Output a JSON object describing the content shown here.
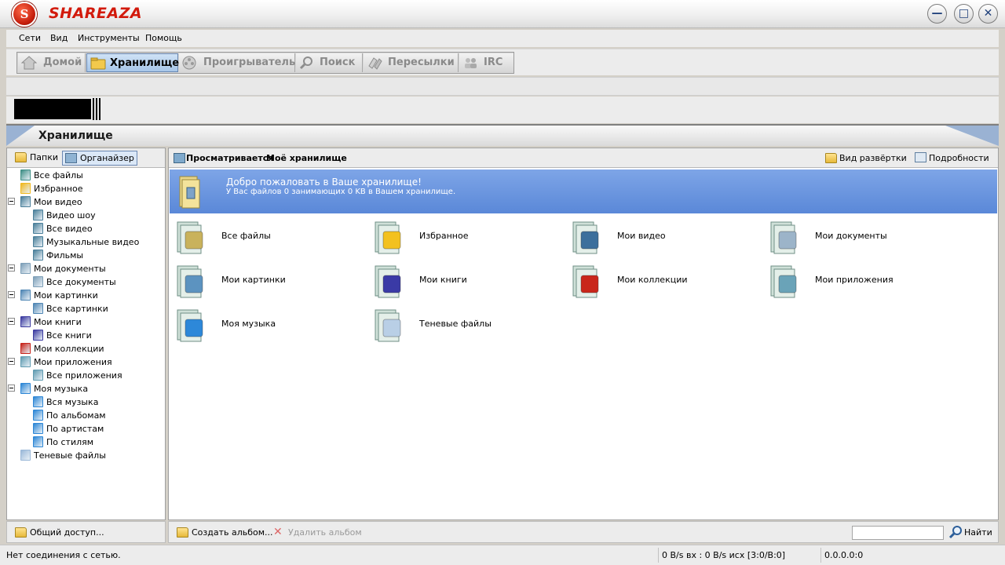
{
  "app": {
    "title": "SHAREAZA",
    "logo_letter": "S"
  },
  "window_buttons": [
    "—",
    "□",
    "✕"
  ],
  "menu": [
    "Сети",
    "Вид",
    "Инструменты",
    "Помощь"
  ],
  "nav": [
    {
      "label": "Домой",
      "icon": "home-icon"
    },
    {
      "label": "Хранилище",
      "icon": "library-folder-icon",
      "active": true
    },
    {
      "label": "Проигрыватель",
      "icon": "film-reel-icon"
    },
    {
      "label": "Поиск",
      "icon": "magnifier-icon"
    },
    {
      "label": "Пересылки",
      "icon": "transfers-icon"
    },
    {
      "label": "IRC",
      "icon": "chat-users-icon"
    }
  ],
  "section_title": "Хранилище",
  "left_tabs": [
    "Папки",
    "Органайзер"
  ],
  "tree": [
    {
      "label": "Все файлы",
      "icon": "library-icon",
      "level": 0,
      "expander": false,
      "color": "#3f8f86"
    },
    {
      "label": "Избранное",
      "icon": "star-icon",
      "level": 0,
      "expander": false,
      "color": "#f0b81e"
    },
    {
      "label": "Мои видео",
      "icon": "video-icon",
      "level": 0,
      "expander": true,
      "color": "#4a7f9a"
    },
    {
      "label": "Видео шоу",
      "icon": "video-icon",
      "level": 1,
      "expander": false,
      "color": "#4a7f9a"
    },
    {
      "label": "Все видео",
      "icon": "video-icon",
      "level": 1,
      "expander": false,
      "color": "#4a7f9a"
    },
    {
      "label": "Музыкальные видео",
      "icon": "video-icon",
      "level": 1,
      "expander": false,
      "color": "#4a7f9a"
    },
    {
      "label": "Фильмы",
      "icon": "video-icon",
      "level": 1,
      "expander": false,
      "color": "#4a7f9a"
    },
    {
      "label": "Мои документы",
      "icon": "documents-icon",
      "level": 0,
      "expander": true,
      "color": "#7d9fb8"
    },
    {
      "label": "Все документы",
      "icon": "documents-icon",
      "level": 1,
      "expander": false,
      "color": "#7d9fb8"
    },
    {
      "label": "Мои картинки",
      "icon": "pictures-icon",
      "level": 0,
      "expander": true,
      "color": "#4f86b4"
    },
    {
      "label": "Все картинки",
      "icon": "pictures-icon",
      "level": 1,
      "expander": false,
      "color": "#4f86b4"
    },
    {
      "label": "Мои книги",
      "icon": "books-icon",
      "level": 0,
      "expander": true,
      "color": "#3b3aa0"
    },
    {
      "label": "Все книги",
      "icon": "books-icon",
      "level": 1,
      "expander": false,
      "color": "#3b3aa0"
    },
    {
      "label": "Мои коллекции",
      "icon": "collections-icon",
      "level": 0,
      "expander": false,
      "color": "#c7231a"
    },
    {
      "label": "Мои приложения",
      "icon": "applications-icon",
      "level": 0,
      "expander": true,
      "color": "#5f9bb1"
    },
    {
      "label": "Все приложения",
      "icon": "applications-icon",
      "level": 1,
      "expander": false,
      "color": "#5f9bb1"
    },
    {
      "label": "Моя музыка",
      "icon": "music-icon",
      "level": 0,
      "expander": true,
      "color": "#2c86d6"
    },
    {
      "label": "Вся музыка",
      "icon": "music-icon",
      "level": 1,
      "expander": false,
      "color": "#2c86d6"
    },
    {
      "label": "По альбомам",
      "icon": "music-icon",
      "level": 1,
      "expander": false,
      "color": "#2c86d6"
    },
    {
      "label": "По артистам",
      "icon": "music-icon",
      "level": 1,
      "expander": false,
      "color": "#2c86d6"
    },
    {
      "label": "По стилям",
      "icon": "music-icon",
      "level": 1,
      "expander": false,
      "color": "#2c86d6"
    },
    {
      "label": "Теневые файлы",
      "icon": "recycle-bin-icon",
      "level": 0,
      "expander": false,
      "color": "#9ab8d8"
    }
  ],
  "share_button": "Общий доступ...",
  "viewing": {
    "prefix": "Просматривается",
    "name": "Моё хранилище"
  },
  "view_buttons": {
    "expanded": "Вид развёртки",
    "details": "Подробности"
  },
  "banner": {
    "line1": "Добро пожаловать в Ваше хранилище!",
    "line2": "У Вас файлов 0 занимающих 0 KB в Вашем хранилище."
  },
  "grid_items": [
    {
      "label": "Все файлы",
      "icon": "library-folder-icon",
      "color": "#c9b25c"
    },
    {
      "label": "Избранное",
      "icon": "star-folder-icon",
      "color": "#f3c11f"
    },
    {
      "label": "Мои видео",
      "icon": "video-folder-icon",
      "color": "#3d6f9c"
    },
    {
      "label": "Мои документы",
      "icon": "documents-folder-icon",
      "color": "#9cb4c9"
    },
    {
      "label": "Мои картинки",
      "icon": "pictures-folder-icon",
      "color": "#5c93c0"
    },
    {
      "label": "Мои книги",
      "icon": "books-folder-icon",
      "color": "#3a3aa6"
    },
    {
      "label": "Мои коллекции",
      "icon": "collections-folder-icon",
      "color": "#c9261b"
    },
    {
      "label": "Мои приложения",
      "icon": "applications-folder-icon",
      "color": "#6aa3b8"
    },
    {
      "label": "Моя музыка",
      "icon": "music-folder-icon",
      "color": "#2d88d9"
    },
    {
      "label": "Теневые файлы",
      "icon": "recycle-bin-icon",
      "color": "#b9cfe6"
    }
  ],
  "album_bar": {
    "create": "Создать альбом...",
    "delete": "Удалить альбом",
    "search_value": "",
    "find": "Найти"
  },
  "status": {
    "connection": "Нет соединения с сетью.",
    "bandwidth": "0 B/s вх : 0 B/s исх [3:0/B:0]",
    "address": "0.0.0.0:0"
  }
}
